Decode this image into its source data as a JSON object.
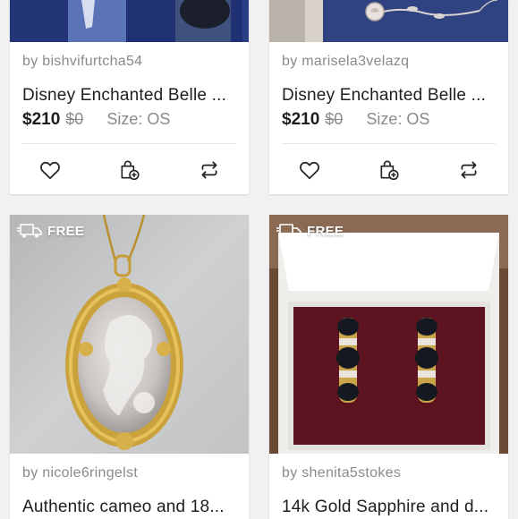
{
  "listings": [
    {
      "seller": "by bishvifurtcha54",
      "title": "Disney Enchanted Belle ...",
      "price": "$210",
      "original_price": "$0",
      "size": "Size: OS",
      "badge": "",
      "image": "belle-pendant-box-blue"
    },
    {
      "seller": "by marisela3velazq",
      "title": "Disney Enchanted Belle ...",
      "price": "$210",
      "original_price": "$0",
      "size": "Size: OS",
      "badge": "",
      "image": "rose-pendant-on-blue"
    },
    {
      "seller": "by nicole6ringelst",
      "title": "Authentic cameo and 18...",
      "badge": "FREE",
      "image": "gold-cameo-pendant"
    },
    {
      "seller": "by shenita5stokes",
      "title": "14k Gold Sapphire and d...",
      "badge": "FREE",
      "image": "sapphire-earrings-in-box"
    }
  ],
  "icons": {
    "like": "heart-icon",
    "bundle": "shopping-bag-plus-icon",
    "share": "share-arrows-icon",
    "shipping": "truck-icon"
  },
  "colors": {
    "background": "#f1f1f1",
    "card": "#ffffff",
    "text_muted": "#8a8a8a",
    "text_main": "#1e1e1e"
  }
}
